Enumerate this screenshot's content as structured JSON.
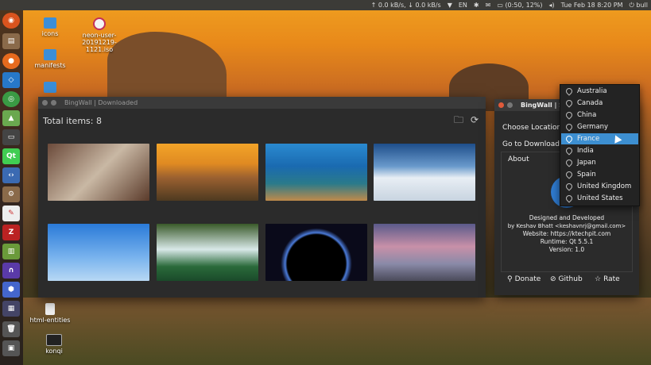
{
  "panel": {
    "net": "0.0 kB/s, ↓ 0.0 kB/s",
    "kbd": "EN",
    "battery": "(0:50, 12%)",
    "clock": "Tue Feb 18  8:20 PM",
    "user": "bull"
  },
  "desktop": {
    "icons": [
      {
        "label": "icons"
      },
      {
        "label": "neon-user-20191219-1121.iso"
      },
      {
        "label": "manifests"
      },
      {
        "label": "html-entities"
      },
      {
        "label": "konqi"
      }
    ]
  },
  "main_window": {
    "title": "BingWall | Downloaded",
    "total": "Total items: 8",
    "thumbnails": [
      "corridor",
      "mountain-sunset",
      "coral-reef",
      "sea-of-clouds",
      "umbrella-dancers",
      "waterfall",
      "planet-eclipse",
      "temple-peak"
    ]
  },
  "settings_window": {
    "title": "BingWall | Set",
    "choose_location": "Choose Location",
    "go_downloads": "Go to Downloads",
    "about": "About",
    "info_lines": [
      "Designed and Developed",
      "by Keshav Bhatt <keshavnrj@gmail.com>",
      "Website: https://ktechpit.com",
      "Runtime: Qt 5.5.1",
      "Version: 1.0"
    ],
    "donate": "Donate",
    "github": "Github",
    "rate": "Rate"
  },
  "dropdown": {
    "options": [
      "Australia",
      "Canada",
      "China",
      "Germany",
      "France",
      "India",
      "Japan",
      "Spain",
      "United Kingdom",
      "United States"
    ],
    "selected": "France"
  },
  "colors": {
    "accent": "#3d8fd1",
    "window": "#2b2b2b",
    "panel": "#3c3b37"
  }
}
